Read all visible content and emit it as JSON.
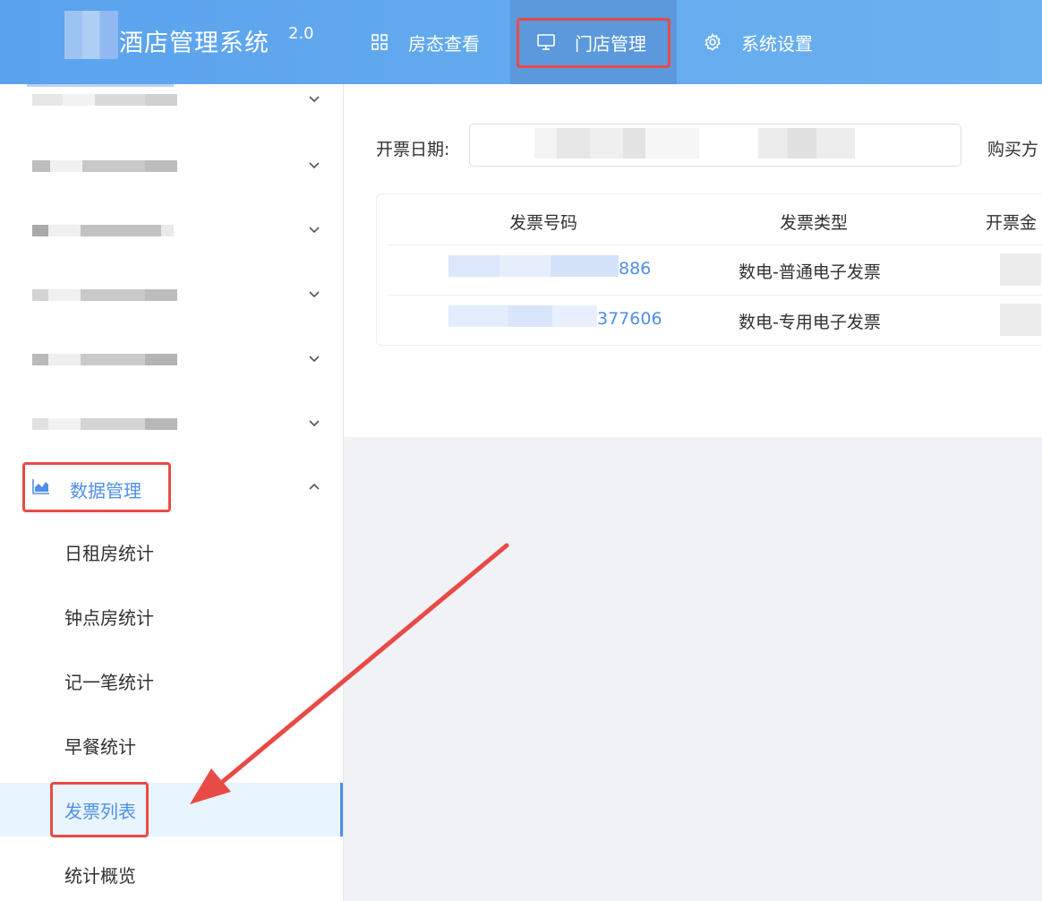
{
  "header": {
    "app_title": "酒店管理系统",
    "version": "2.0",
    "nav": [
      {
        "label": "房态查看",
        "icon": "grid-icon"
      },
      {
        "label": "门店管理",
        "icon": "monitor-icon",
        "active": true
      },
      {
        "label": "系统设置",
        "icon": "gear-icon"
      }
    ]
  },
  "sidebar": {
    "section": {
      "label": "数据管理",
      "icon": "chart-area-icon",
      "expanded": true
    },
    "sub_items": [
      {
        "label": "日租房统计"
      },
      {
        "label": "钟点房统计"
      },
      {
        "label": "记一笔统计"
      },
      {
        "label": "早餐统计"
      },
      {
        "label": "发票列表",
        "active": true
      },
      {
        "label": "统计概览"
      }
    ]
  },
  "filters": {
    "invoice_date_label": "开票日期:",
    "buyer_label": "购买方"
  },
  "table": {
    "columns": [
      "发票号码",
      "发票类型",
      "开票金"
    ],
    "rows": [
      {
        "invoice_no_tail": "886",
        "type": "数电-普通电子发票"
      },
      {
        "invoice_no_tail": "377606",
        "type": "数电-专用电子发票"
      }
    ]
  },
  "colors": {
    "header": "#5aa2ee",
    "accent": "#4f8fe6",
    "highlight": "#e84a46"
  }
}
